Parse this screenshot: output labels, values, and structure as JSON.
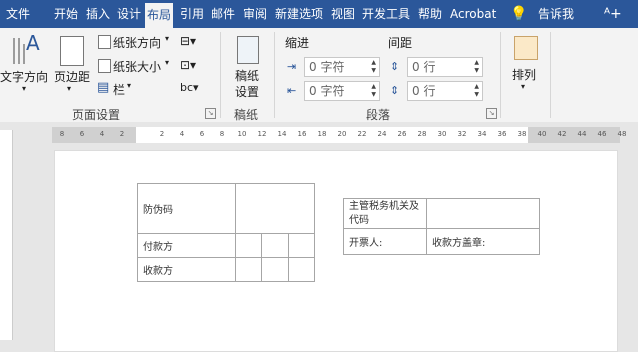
{
  "tabs": [
    "文件",
    "开始",
    "插入",
    "设计",
    "布局",
    "引用",
    "邮件",
    "审阅",
    "新建选项",
    "视图",
    "开发工具",
    "帮助",
    "Acrobat"
  ],
  "tell_me": "告诉我",
  "ribbon": {
    "page_setup": {
      "text_direction": "文字方向",
      "margins": "页边距",
      "orientation": "纸张方向",
      "size": "纸张大小",
      "columns": "栏",
      "label": "页面设置"
    },
    "manuscript": {
      "button": "稿纸\n设置",
      "label": "稿纸"
    },
    "paragraph": {
      "indent_title": "缩进",
      "spacing_title": "间距",
      "indent_left": "0 字符",
      "indent_right": "0 字符",
      "spacing_before": "0 行",
      "spacing_after": "0 行",
      "label": "段落"
    },
    "arrange": {
      "label": "排列"
    }
  },
  "ruler": {
    "ticks": [
      "8",
      "6",
      "4",
      "2",
      "",
      "2",
      "4",
      "6",
      "8",
      "10",
      "12",
      "14",
      "16",
      "18",
      "20",
      "22",
      "24",
      "26",
      "28",
      "30",
      "32",
      "34",
      "36",
      "38",
      "40",
      "42",
      "44",
      "46",
      "48"
    ]
  },
  "document": {
    "left_table": {
      "anti_fake": "防伪码",
      "payer": "付款方",
      "payee": "收款方"
    },
    "right_table": {
      "tax_office": "主管税务机关及代码",
      "drawer": "开票人:",
      "payee_seal": "收款方盖章:"
    }
  }
}
